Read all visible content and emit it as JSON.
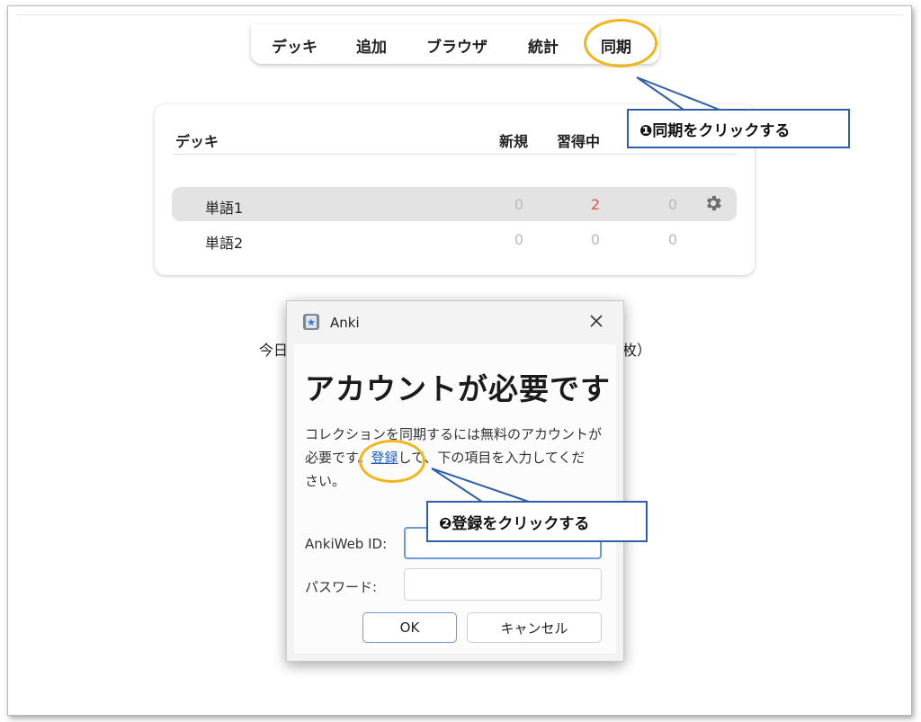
{
  "nav": {
    "decks": "デッキ",
    "add": "追加",
    "browse": "ブラウザ",
    "stats": "統計",
    "sync": "同期"
  },
  "deck_table": {
    "headers": {
      "deck": "デッキ",
      "new": "新規",
      "learn": "習得中",
      "due": ""
    },
    "rows": [
      {
        "name": "単語1",
        "new": "0",
        "learn": "2",
        "due": "0"
      },
      {
        "name": "単語2",
        "new": "0",
        "learn": "0",
        "due": "0"
      }
    ]
  },
  "status": {
    "left_fragment": "今日",
    "right_fragment": "枚）"
  },
  "dialog": {
    "title": "Anki",
    "heading": "アカウントが必要です",
    "line1": "コレクションを同期するには無料のアカウントが",
    "line2_before": "必要です。",
    "line2_link": "登録",
    "line2_after": "して、下の項目を入力してくだ",
    "line3": "さい。",
    "id_label": "AnkiWeb ID:",
    "id_value": "",
    "password_label": "パスワード:",
    "password_value": "",
    "ok_label": "OK",
    "cancel_label": "キャンセル"
  },
  "annotations": {
    "step1": "❶同期をクリックする",
    "step2": "❷登録をクリックする"
  },
  "colors": {
    "highlight": "#f2b51d",
    "callout_border": "#2f5fab",
    "learn_count": "#e15454",
    "link": "#1f5fc5"
  }
}
